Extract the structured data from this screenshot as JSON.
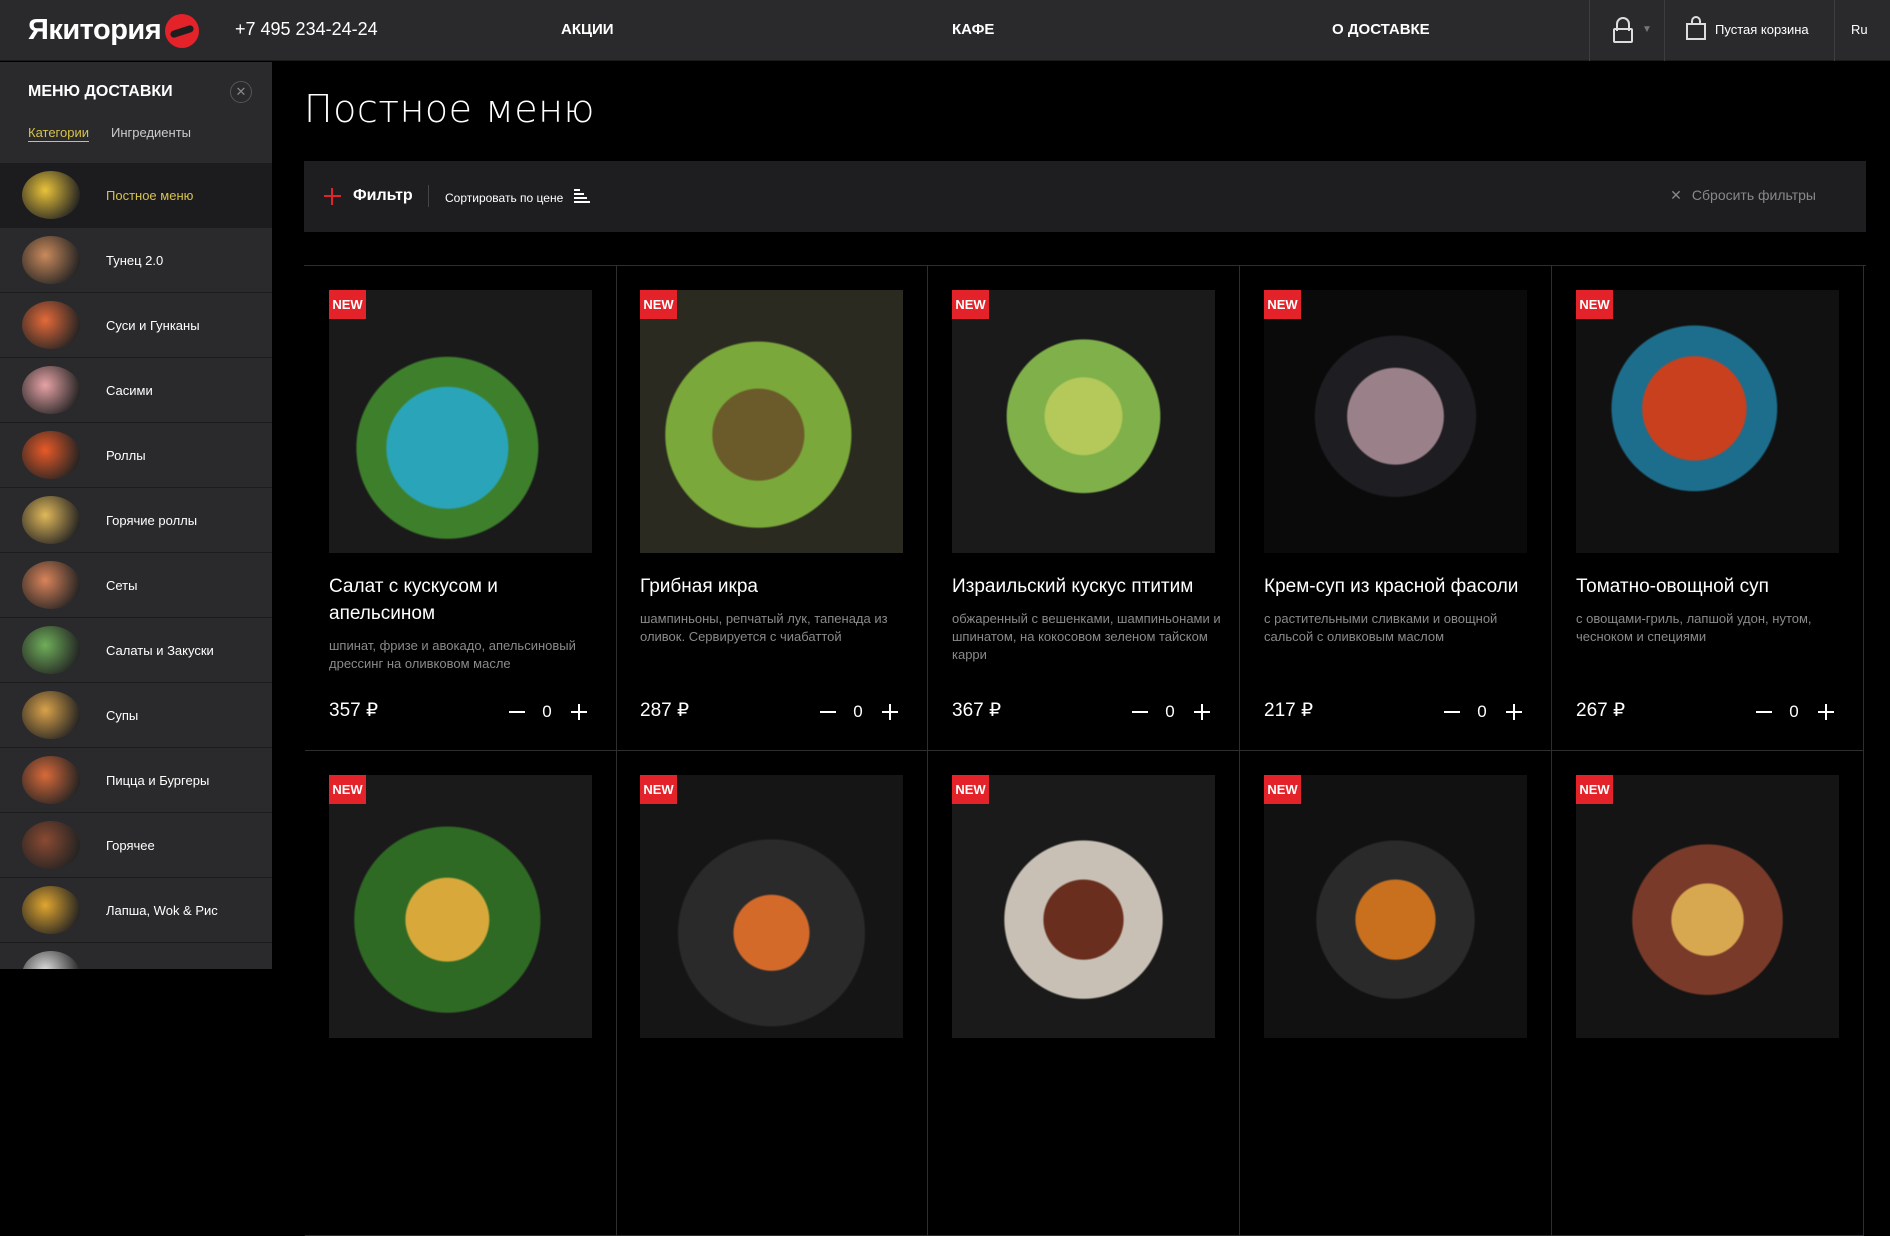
{
  "header": {
    "logo": "Якитория",
    "phone": "+7 495 234-24-24",
    "nav": [
      "АКЦИИ",
      "КАФЕ",
      "О ДОСТАВКЕ"
    ],
    "cart_label": "Пустая корзина",
    "lang": "Ru",
    "accent": "#e4222a"
  },
  "sidebar": {
    "title": "МЕНЮ ДОСТАВКИ",
    "tabs": [
      "Категории",
      "Ингредиенты"
    ],
    "items": [
      {
        "label": "Постное меню",
        "active": true
      },
      {
        "label": "Тунец 2.0"
      },
      {
        "label": "Суси и Гунканы"
      },
      {
        "label": "Сасими"
      },
      {
        "label": "Роллы"
      },
      {
        "label": "Горячие роллы"
      },
      {
        "label": "Сеты"
      },
      {
        "label": "Салаты и Закуски"
      },
      {
        "label": "Супы"
      },
      {
        "label": "Пицца и Бургеры"
      },
      {
        "label": "Горячее"
      },
      {
        "label": "Лапша, Wok & Рис"
      },
      {
        "label": ""
      }
    ]
  },
  "main": {
    "title": "Постное меню",
    "filter_label": "Фильтр",
    "sort_label": "Сортировать по цене",
    "reset_label": "Сбросить фильтры",
    "badge": "NEW",
    "products": [
      {
        "title": "Салат с кускусом и апельсином",
        "desc": "шпинат, фризе и авокадо, апельсиновый дрессинг на оливковом масле",
        "price": "357 ₽",
        "qty": "0"
      },
      {
        "title": "Грибная икра",
        "desc": "шампиньоны, репчатый лук, тапенада из оливок. Сервируется с чиабаттой",
        "price": "287 ₽",
        "qty": "0"
      },
      {
        "title": "Израильский кускус птитим",
        "desc": "обжаренный с вешенками, шампиньонами и шпинатом, на кокосовом зеленом тайском карри",
        "price": "367 ₽",
        "qty": "0"
      },
      {
        "title": "Крем-суп из красной фасоли",
        "desc": "с растительными сливками и овощной сальсой с оливковым маслом",
        "price": "217 ₽",
        "qty": "0"
      },
      {
        "title": "Томатно-овощной суп",
        "desc": "с овощами-гриль, лапшой удон, нутом, чесноком и специями",
        "price": "267 ₽",
        "qty": "0"
      },
      {},
      {},
      {},
      {},
      {}
    ]
  }
}
